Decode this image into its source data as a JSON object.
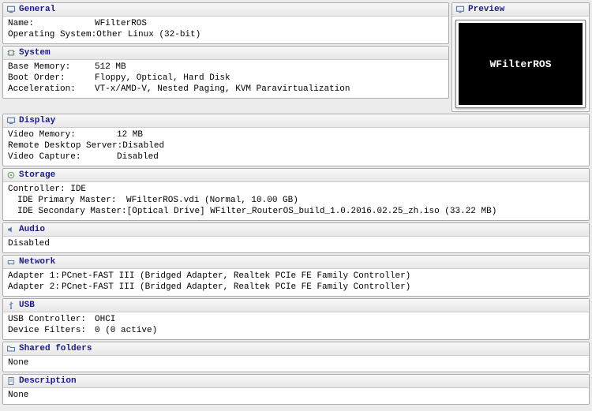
{
  "preview": {
    "title": "Preview",
    "text": "WFilterROS"
  },
  "general": {
    "title": "General",
    "name_lbl": "Name:",
    "name": "WFilterROS",
    "os_lbl": "Operating System:",
    "os": "Other Linux (32-bit)"
  },
  "system": {
    "title": "System",
    "mem_lbl": "Base Memory:",
    "mem": "512 MB",
    "boot_lbl": "Boot Order:",
    "boot": "Floppy, Optical, Hard Disk",
    "acc_lbl": "Acceleration:",
    "acc": "VT-x/AMD-V, Nested Paging, KVM Paravirtualization"
  },
  "display": {
    "title": "Display",
    "vmem_lbl": "Video Memory:",
    "vmem": "12 MB",
    "rds_lbl": "Remote Desktop Server:",
    "rds": "Disabled",
    "vc_lbl": "Video Capture:",
    "vc": "Disabled"
  },
  "storage": {
    "title": "Storage",
    "ctrl": "Controller: IDE",
    "pm_lbl": "IDE Primary Master:",
    "pm": "WFilterROS.vdi (Normal, 10.00 GB)",
    "sm_lbl": "IDE Secondary Master:",
    "sm": "[Optical Drive] WFilter_RouterOS_build_1.0.2016.02.25_zh.iso (33.22 MB)"
  },
  "audio": {
    "title": "Audio",
    "val": "Disabled"
  },
  "network": {
    "title": "Network",
    "a1_lbl": "Adapter 1:",
    "a1": "PCnet-FAST III (Bridged Adapter, Realtek PCIe FE Family Controller)",
    "a2_lbl": "Adapter 2:",
    "a2": "PCnet-FAST III (Bridged Adapter, Realtek PCIe FE Family Controller)"
  },
  "usb": {
    "title": "USB",
    "c_lbl": "USB Controller:",
    "c": "OHCI",
    "f_lbl": "Device Filters:",
    "f": "0 (0 active)"
  },
  "shared": {
    "title": "Shared folders",
    "val": "None"
  },
  "desc": {
    "title": "Description",
    "val": "None"
  }
}
